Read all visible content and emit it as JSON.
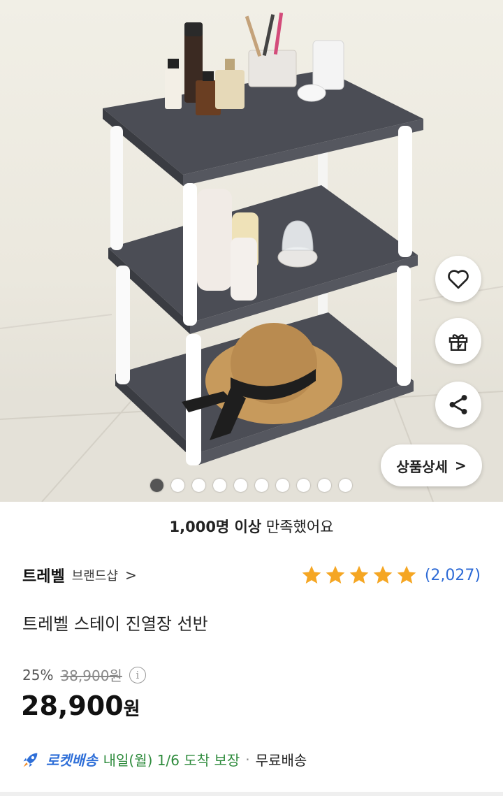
{
  "gallery": {
    "dot_count": 10,
    "active_index": 0,
    "detail_button_label": "상품상세",
    "detail_button_chevron": ">"
  },
  "actions": {
    "like_icon": "heart-icon",
    "gift_icon": "gift-icon",
    "share_icon": "share-icon"
  },
  "satisfaction": {
    "bold": "1,000명 이상",
    "rest": " 만족했어요"
  },
  "brand": {
    "name": "트레벨",
    "shop_label": "브랜드샵",
    "chevron": ">"
  },
  "rating": {
    "stars": 5,
    "review_count": "(2,027)",
    "star_color": "#f5a623"
  },
  "product": {
    "title": "트레벨 스테이 진열장 선반"
  },
  "price": {
    "discount": "25%",
    "original": "38,900원",
    "info_icon": "i",
    "sale_amount": "28,900",
    "sale_unit": "원"
  },
  "delivery": {
    "rocket_label": "로켓배송",
    "eta": "내일(월) 1/6 도착 보장",
    "separator": "·",
    "free": "무료배송",
    "rocket_color": "#2f6fd8",
    "eta_color": "#2e8b3c"
  }
}
